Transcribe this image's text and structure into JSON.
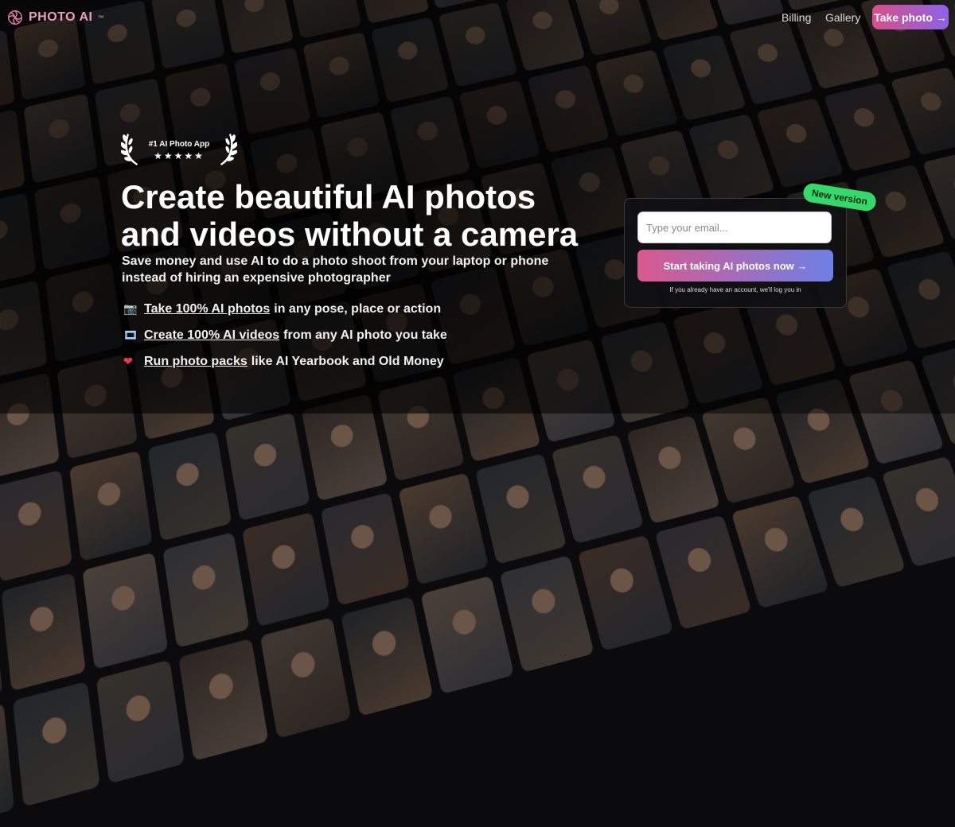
{
  "brand": {
    "name": "PHOTO AI",
    "sup": "™"
  },
  "nav": {
    "billing": "Billing",
    "gallery": "Gallery",
    "cta": "Take photo →"
  },
  "badge": {
    "title": "#1 AI Photo App",
    "stars": "★★★★★"
  },
  "hero": {
    "headline_line1": "Create beautiful AI photos",
    "headline_line2": "and videos without a camera",
    "subhead_line1": "Save money and use AI to do a photo shoot from your laptop or phone",
    "subhead_line2": "instead of hiring an expensive photographer"
  },
  "features": [
    {
      "icon": "📷",
      "icon_name": "camera-icon",
      "link": "Take 100% AI photos",
      "rest": "in any pose, place or action"
    },
    {
      "icon": "🎞",
      "icon_name": "film-icon",
      "link": "Create 100% AI videos",
      "rest": "from any AI photo you take"
    },
    {
      "icon": "❤",
      "icon_name": "heart-icon",
      "link": "Run photo packs",
      "rest": "like AI Yearbook and Old Money"
    }
  ],
  "signup": {
    "placeholder": "Type your email...",
    "button": "Start taking AI photos now →",
    "note": "If you already have an account, we'll log you in",
    "new_badge": "New version"
  },
  "colors": {
    "accent_pink": "#d94e8a",
    "accent_purple": "#8a63e6",
    "new_badge_green": "#35d86a"
  }
}
